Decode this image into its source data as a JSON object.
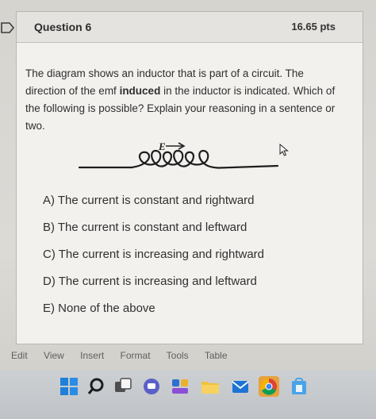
{
  "question": {
    "title": "Question 6",
    "points": "16.65 pts",
    "text_part1": "The diagram shows an inductor that is part of a circuit. The direction of the emf ",
    "text_bold": "induced",
    "text_part2": " in the inductor is indicated. Which of the following is possible? Explain your reasoning in a sentence or two.",
    "diagram_label": "E"
  },
  "answers": [
    "A) The current is constant and rightward",
    "B) The current is constant and leftward",
    "C) The current is increasing and rightward",
    "D) The current is increasing and leftward",
    "E) None of the above"
  ],
  "editor_menu": [
    "Edit",
    "View",
    "Insert",
    "Format",
    "Tools",
    "Table"
  ],
  "taskbar_icons": [
    "windows-start-icon",
    "search-icon",
    "task-view-icon",
    "chat-icon",
    "widgets-icon",
    "file-explorer-icon",
    "mail-icon",
    "chrome-icon",
    "store-icon"
  ],
  "colors": {
    "card_bg": "#f2f1ee",
    "header_bg": "#e4e3df",
    "text": "#2e2e2e"
  }
}
